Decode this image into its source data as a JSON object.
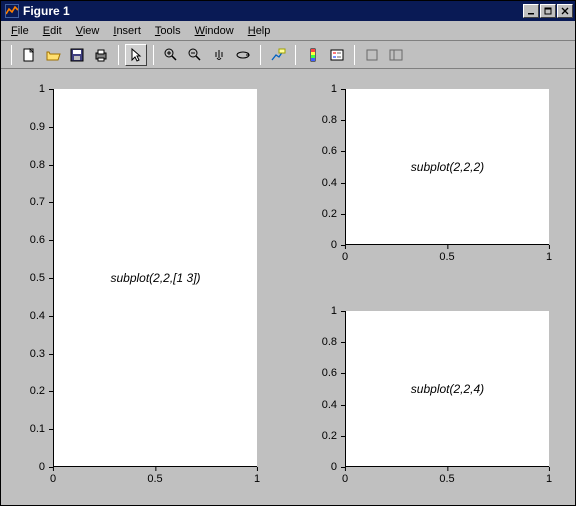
{
  "window_title": "Figure 1",
  "menubar": {
    "file": "File",
    "edit": "Edit",
    "view": "View",
    "insert": "Insert",
    "tools": "Tools",
    "window": "Window",
    "help": "Help"
  },
  "chart_data": [
    {
      "type": "line",
      "title": "subplot(2,2,[1 3])",
      "position": "span-left",
      "xticks": [
        0,
        0.5,
        1
      ],
      "yticks": [
        0,
        0.1,
        0.2,
        0.3,
        0.4,
        0.5,
        0.6,
        0.7,
        0.8,
        0.9,
        1
      ],
      "xlim": [
        0,
        1
      ],
      "ylim": [
        0,
        1
      ],
      "series": []
    },
    {
      "type": "line",
      "title": "subplot(2,2,2)",
      "position": "top-right",
      "xticks": [
        0,
        0.5,
        1
      ],
      "yticks": [
        0,
        0.2,
        0.4,
        0.6,
        0.8,
        1
      ],
      "xlim": [
        0,
        1
      ],
      "ylim": [
        0,
        1
      ],
      "series": []
    },
    {
      "type": "line",
      "title": "subplot(2,2,4)",
      "position": "bottom-right",
      "xticks": [
        0,
        0.5,
        1
      ],
      "yticks": [
        0,
        0.2,
        0.4,
        0.6,
        0.8,
        1
      ],
      "xlim": [
        0,
        1
      ],
      "ylim": [
        0,
        1
      ],
      "series": []
    }
  ]
}
